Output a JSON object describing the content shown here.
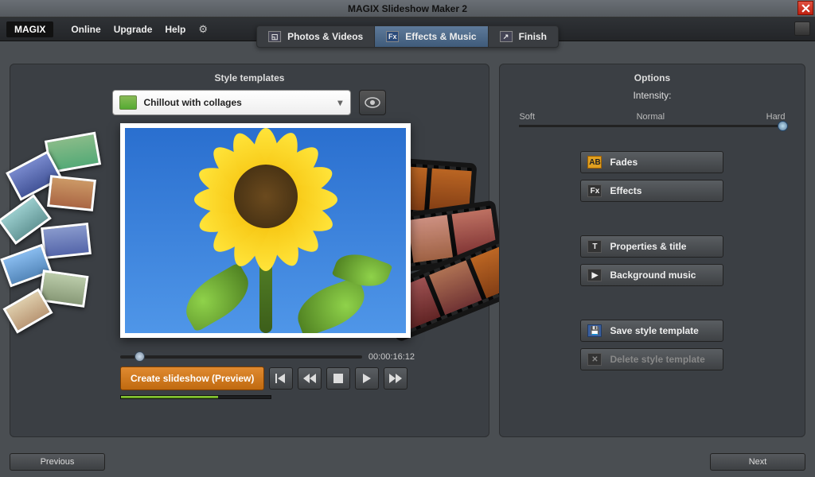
{
  "window": {
    "title": "MAGIX Slideshow Maker 2"
  },
  "logo": "MAGIX",
  "menu": {
    "online": "Online",
    "upgrade": "Upgrade",
    "help": "Help"
  },
  "tabs": {
    "photos": "Photos & Videos",
    "effects": "Effects & Music",
    "finish": "Finish"
  },
  "left_panel": {
    "title": "Style templates",
    "style_dropdown": "Chillout with collages",
    "timecode": "00:00:16:12",
    "create_btn": "Create slideshow (Preview)"
  },
  "right_panel": {
    "title": "Options",
    "intensity_label": "Intensity:",
    "intensity_soft": "Soft",
    "intensity_normal": "Normal",
    "intensity_hard": "Hard",
    "fades": "Fades",
    "effects": "Effects",
    "properties": "Properties & title",
    "bgmusic": "Background music",
    "save_style": "Save style template",
    "delete_style": "Delete style template"
  },
  "footer": {
    "previous": "Previous",
    "next": "Next"
  }
}
